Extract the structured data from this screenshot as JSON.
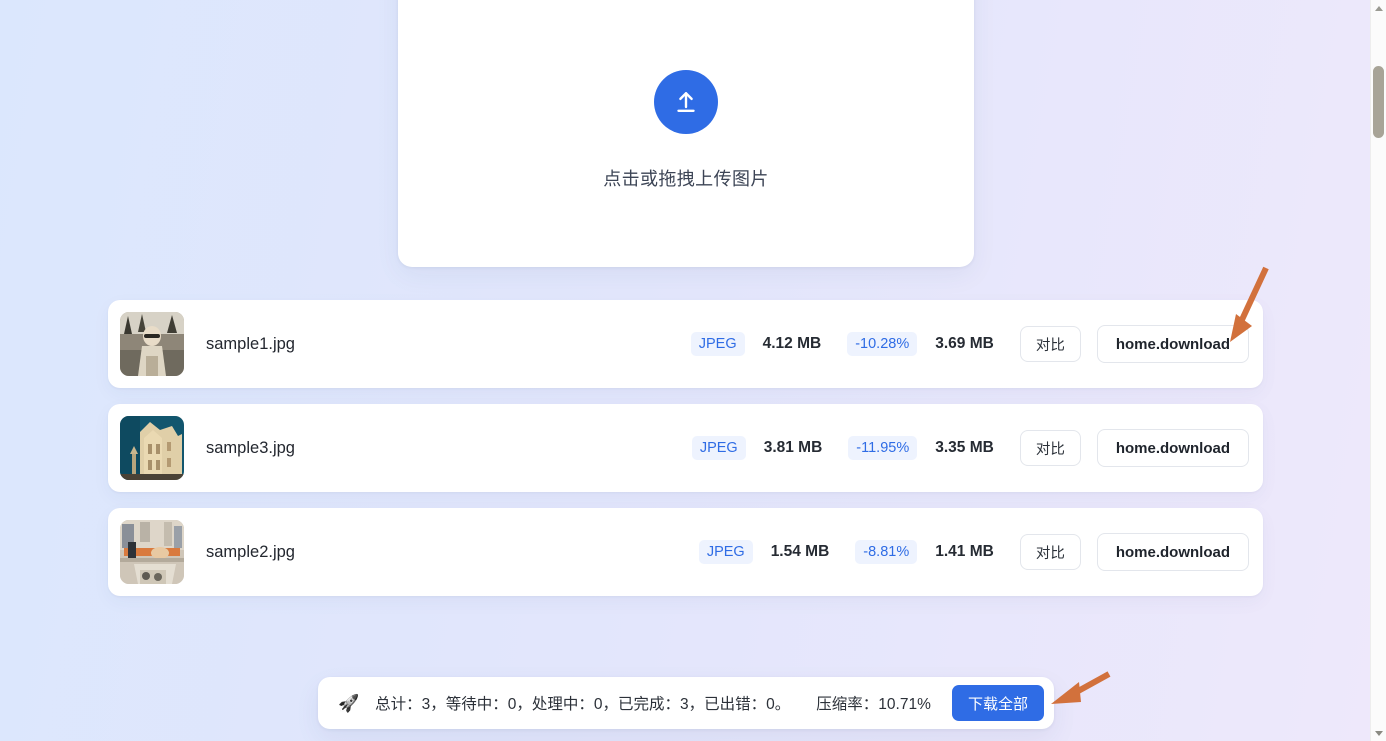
{
  "uploader": {
    "icon": "upload-arrow-icon",
    "hint": "点击或拖拽上传图片"
  },
  "files": [
    {
      "thumbnail": "photo-person-outdoors",
      "name": "sample1.jpg",
      "format": "JPEG",
      "original_size": "4.12 MB",
      "delta": "-10.28%",
      "compressed_size": "3.69 MB",
      "compare_label": "对比",
      "download_label": "home.download"
    },
    {
      "thumbnail": "photo-ornate-building",
      "name": "sample3.jpg",
      "format": "JPEG",
      "original_size": "3.81 MB",
      "delta": "-11.95%",
      "compressed_size": "3.35 MB",
      "compare_label": "对比",
      "download_label": "home.download"
    },
    {
      "thumbnail": "photo-street-scene",
      "name": "sample2.jpg",
      "format": "JPEG",
      "original_size": "1.54 MB",
      "delta": "-8.81%",
      "compressed_size": "1.41 MB",
      "compare_label": "对比",
      "download_label": "home.download"
    }
  ],
  "summary": {
    "icon": "rocket-icon",
    "stats_text": "总计：3，等待中：0，处理中：0，已完成：3，已出错：0。",
    "ratio_text": "压缩率：10.71%",
    "download_all_label": "下载全部"
  },
  "annotations": [
    {
      "name": "arrow-to-download-button",
      "color": "#d2713c"
    },
    {
      "name": "arrow-to-download-all-button",
      "color": "#d2713c"
    }
  ],
  "colors": {
    "accent": "#2f6ce5",
    "badge_bg": "#eef3fe",
    "card_bg": "#ffffff",
    "bg_left": "#dbe7fd",
    "bg_right": "#eee8fb",
    "annotation": "#d2713c"
  },
  "scrollbar": {
    "up_arrow": "scroll-up-arrow-icon",
    "down_arrow": "scroll-down-arrow-icon"
  }
}
